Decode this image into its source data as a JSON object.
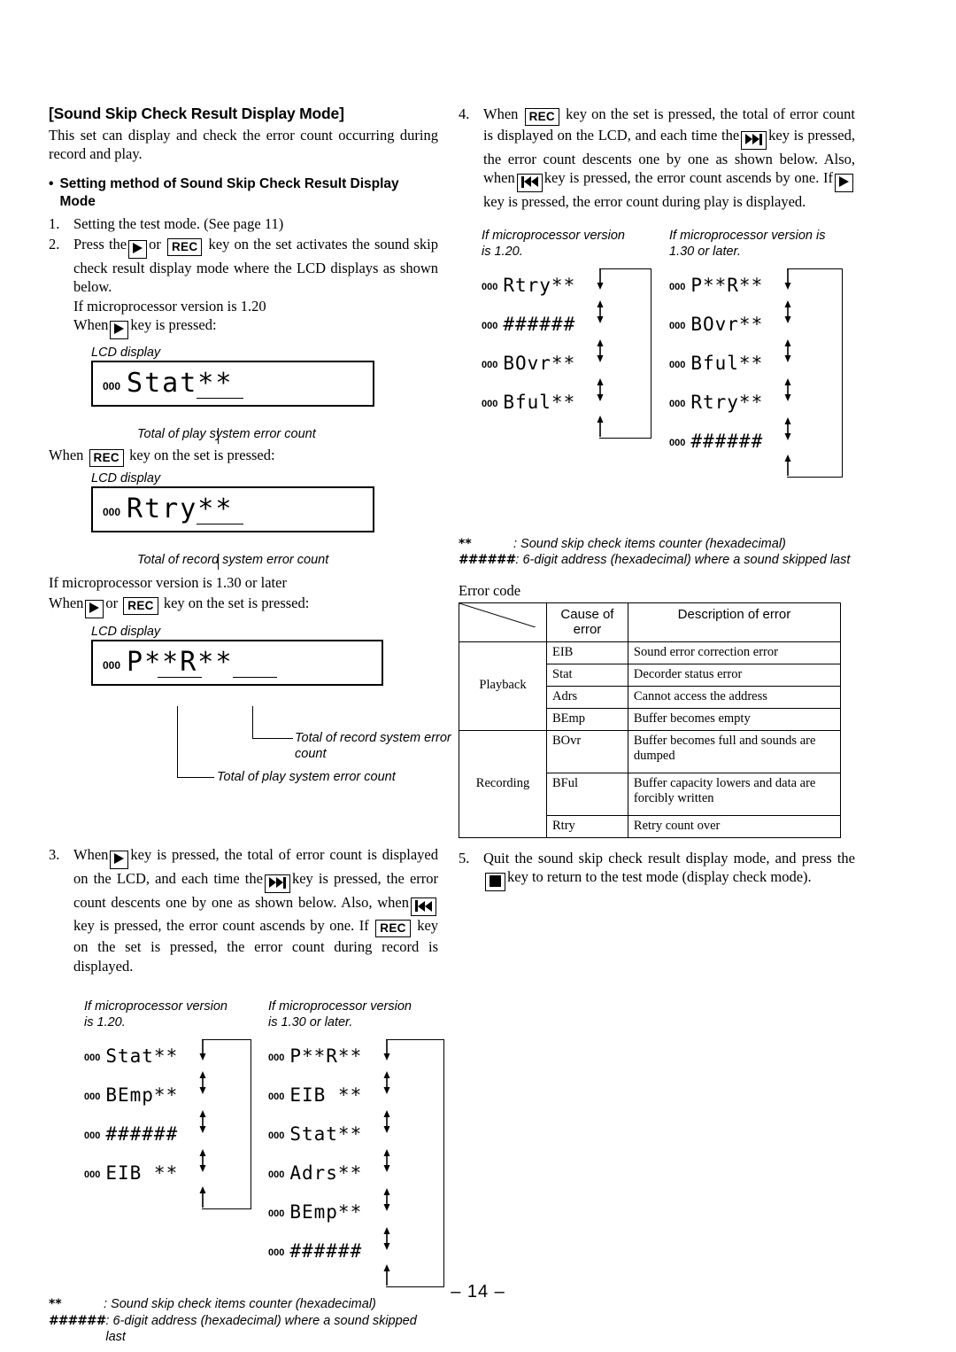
{
  "page": {
    "number": "– 14 –"
  },
  "left": {
    "heading": "[Sound Skip Check Result Display Mode]",
    "intro": "This set can display and check the error count occurring during record and play.",
    "bullet_dot": "•",
    "bullet_heading": "Setting method of Sound Skip Check Result Display Mode",
    "step1": {
      "num": "1.",
      "text": "Setting the test mode. (See page 11)"
    },
    "step2": {
      "num": "2.",
      "part1": "Press the",
      "or": "or",
      "part2": "key on the set activates the sound skip check result display mode where the LCD displays as shown below.",
      "version_line": "If microprocessor version is 1.20",
      "when_pre": "When",
      "when_post": "key is pressed:"
    },
    "lcd_caption": "LCD display",
    "lcd1": {
      "zeros": "000",
      "text": "Stat**"
    },
    "lcd1_note": "Total of play system error count",
    "rec_line": {
      "pre": "When",
      "post": "key on the set is pressed:"
    },
    "lcd2": {
      "zeros": "000",
      "text": "Rtry**"
    },
    "lcd2_note": "Total of record system error count",
    "version130": "If microprocessor version is 1.30 or later",
    "when130": {
      "pre": "When",
      "or": "or",
      "post": "key on the set is pressed:"
    },
    "lcd3": {
      "zeros": "000",
      "text": "P**R**"
    },
    "lcd3_note_record": "Total of record system error count",
    "lcd3_note_play": "Total of play system error count",
    "step3": {
      "num": "3.",
      "t1": "When",
      "t2": "key is pressed, the total of error count is displayed on the LCD, and each time the",
      "t3": "key is pressed, the error count descents one by one as shown below. Also, when",
      "t4": "key is pressed, the error count ascends by one. If",
      "t5": "key on the set is pressed, the error count during record is displayed."
    },
    "flow_caption_120": "If microprocessor version is 1.20.",
    "flow_caption_130": "If microprocessor version is 1.30 or later.",
    "flow_120": [
      {
        "zeros": "000",
        "text": "Stat**"
      },
      {
        "zeros": "000",
        "text": "BEmp**"
      },
      {
        "zeros": "000",
        "text": "######"
      },
      {
        "zeros": "000",
        "text": "EIB **"
      }
    ],
    "flow_130": [
      {
        "zeros": "000",
        "text": "P**R**"
      },
      {
        "zeros": "000",
        "text": "EIB **"
      },
      {
        "zeros": "000",
        "text": "Stat**"
      },
      {
        "zeros": "000",
        "text": "Adrs**"
      },
      {
        "zeros": "000",
        "text": "BEmp**"
      },
      {
        "zeros": "000",
        "text": "######"
      }
    ],
    "footnotes": [
      {
        "symbol": "**",
        "desc": ": Sound skip check items counter (hexadecimal)"
      },
      {
        "symbol": "######",
        "desc": ": 6-digit address (hexadecimal) where a sound skipped last"
      }
    ]
  },
  "right": {
    "step4": {
      "num": "4.",
      "t1": "When",
      "t2": "key on the set is pressed, the total of error count is displayed on the LCD, and each time the",
      "t3": "key is pressed, the error count descents one by one as shown below. Also, when",
      "t4": "key is pressed, the error count ascends by one. If",
      "t5": "key is pressed, the error count during play is displayed."
    },
    "flow_caption_120": "If microprocessor version is 1.20.",
    "flow_caption_130": "If microprocessor version is 1.30 or later.",
    "flow_120": [
      {
        "zeros": "000",
        "text": "Rtry**"
      },
      {
        "zeros": "000",
        "text": "######"
      },
      {
        "zeros": "000",
        "text": "BOvr**"
      },
      {
        "zeros": "000",
        "text": "Bful**"
      }
    ],
    "flow_130": [
      {
        "zeros": "000",
        "text": "P**R**"
      },
      {
        "zeros": "000",
        "text": "BOvr**"
      },
      {
        "zeros": "000",
        "text": "Bful**"
      },
      {
        "zeros": "000",
        "text": "Rtry**"
      },
      {
        "zeros": "000",
        "text": "######"
      }
    ],
    "footnotes": [
      {
        "symbol": "**",
        "desc": ": Sound skip check items counter (hexadecimal)"
      },
      {
        "symbol": "######",
        "desc": ": 6-digit address (hexadecimal) where a sound skipped last"
      }
    ],
    "table_title": "Error code",
    "table": {
      "headers": [
        "",
        "Cause of error",
        "Description of error"
      ],
      "groups": [
        {
          "label": "Playback",
          "rows": [
            {
              "cause": "EIB",
              "desc": "Sound error correction error"
            },
            {
              "cause": "Stat",
              "desc": "Decorder status error"
            },
            {
              "cause": "Adrs",
              "desc": "Cannot access the address"
            },
            {
              "cause": "BEmp",
              "desc": "Buffer becomes empty"
            }
          ]
        },
        {
          "label": "Recording",
          "rows": [
            {
              "cause": "BOvr",
              "desc": "Buffer becomes full and sounds are dumped"
            },
            {
              "cause": "BFul",
              "desc": "Buffer capacity lowers and data are forcibly written"
            },
            {
              "cause": "Rtry",
              "desc": "Retry count over"
            }
          ]
        }
      ]
    },
    "step5": {
      "num": "5.",
      "t1": "Quit the sound skip check result display mode, and  press the",
      "t2": "key to return to the test mode (display check mode)."
    }
  }
}
